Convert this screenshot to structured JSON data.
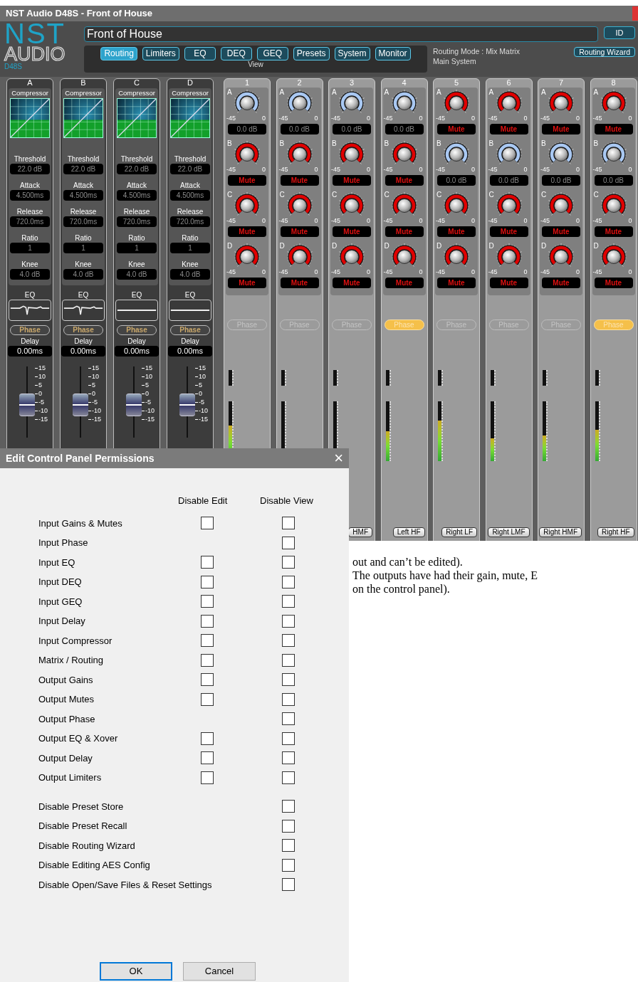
{
  "window": {
    "title": "NST Audio D48S - Front of House"
  },
  "logo": {
    "brand": "NST",
    "line2": "AUDIO",
    "model": "D48S"
  },
  "name_field": {
    "value": "Front of House"
  },
  "id_button": "ID",
  "tabs": [
    {
      "label": "Routing",
      "selected": true
    },
    {
      "label": "Limiters",
      "selected": false
    },
    {
      "label": "EQ",
      "selected": false
    },
    {
      "label": "DEQ",
      "selected": false
    },
    {
      "label": "GEQ",
      "selected": false
    },
    {
      "label": "Presets",
      "selected": false
    },
    {
      "label": "System",
      "selected": false
    },
    {
      "label": "Monitor",
      "selected": false
    }
  ],
  "tabs_caption": "View",
  "routing_mode": "Routing Mode : Mix Matrix",
  "system_name": "Main System",
  "routing_wizard": "Routing Wizard",
  "inputs": [
    {
      "letter": "A",
      "compressor": "Compressor",
      "params": [
        {
          "label": "Threshold",
          "value": "22.0 dB"
        },
        {
          "label": "Attack",
          "value": "4.500ms"
        },
        {
          "label": "Release",
          "value": "720.0ms"
        },
        {
          "label": "Ratio",
          "value": "1"
        },
        {
          "label": "Knee",
          "value": "4.0 dB"
        }
      ],
      "eq": {
        "label": "EQ",
        "kind": "notched"
      },
      "phase": "Phase",
      "delay_label": "Delay",
      "delay": "0.00ms",
      "fader": {
        "level": 0.5,
        "scale": [
          "15",
          "10",
          "5",
          "0",
          "-5",
          "-10",
          "-15"
        ]
      }
    },
    {
      "letter": "B",
      "compressor": "Compressor",
      "params": [
        {
          "label": "Threshold",
          "value": "22.0 dB"
        },
        {
          "label": "Attack",
          "value": "4.500ms"
        },
        {
          "label": "Release",
          "value": "720.0ms"
        },
        {
          "label": "Ratio",
          "value": "1"
        },
        {
          "label": "Knee",
          "value": "4.0 dB"
        }
      ],
      "eq": {
        "label": "EQ",
        "kind": "notched"
      },
      "phase": "Phase",
      "delay_label": "Delay",
      "delay": "0.00ms",
      "fader": {
        "level": 0.5,
        "scale": [
          "15",
          "10",
          "5",
          "0",
          "-5",
          "-10",
          "-15"
        ]
      }
    },
    {
      "letter": "C",
      "compressor": "Compressor",
      "params": [
        {
          "label": "Threshold",
          "value": "22.0 dB"
        },
        {
          "label": "Attack",
          "value": "4.500ms"
        },
        {
          "label": "Release",
          "value": "720.0ms"
        },
        {
          "label": "Ratio",
          "value": "1"
        },
        {
          "label": "Knee",
          "value": "4.0 dB"
        }
      ],
      "eq": {
        "label": "EQ",
        "kind": "flat"
      },
      "phase": "Phase",
      "delay_label": "Delay",
      "delay": "0.00ms",
      "fader": {
        "level": 0.5,
        "scale": [
          "15",
          "10",
          "5",
          "0",
          "-5",
          "-10",
          "-15"
        ]
      }
    },
    {
      "letter": "D",
      "compressor": "Compressor",
      "params": [
        {
          "label": "Threshold",
          "value": "22.0 dB"
        },
        {
          "label": "Attack",
          "value": "4.500ms"
        },
        {
          "label": "Release",
          "value": "720.0ms"
        },
        {
          "label": "Ratio",
          "value": "1"
        },
        {
          "label": "Knee",
          "value": "4.0 dB"
        }
      ],
      "eq": {
        "label": "EQ",
        "kind": "flat"
      },
      "phase": "Phase",
      "delay_label": "Delay",
      "delay": "0.00ms",
      "fader": {
        "level": 0.5,
        "scale": [
          "15",
          "10",
          "5",
          "0",
          "-5",
          "-10",
          "-15"
        ]
      }
    }
  ],
  "outputs": [
    {
      "number": "1",
      "knobs": [
        {
          "label": "A",
          "muted": false,
          "readout": "0.0 dB",
          "scale_min": "-45",
          "scale_max": "0"
        },
        {
          "label": "B",
          "muted": true,
          "readout": "Mute",
          "scale_min": "-45",
          "scale_max": "0"
        },
        {
          "label": "C",
          "muted": true,
          "readout": "Mute",
          "scale_min": "-45",
          "scale_max": "0"
        },
        {
          "label": "D",
          "muted": true,
          "readout": "Mute",
          "scale_min": "-45",
          "scale_max": "0"
        }
      ],
      "phase": {
        "label": "Phase",
        "on": false
      },
      "meter": {
        "level": 0.6
      }
    },
    {
      "number": "2",
      "knobs": [
        {
          "label": "A",
          "muted": false,
          "readout": "0.0 dB",
          "scale_min": "-45",
          "scale_max": "0"
        },
        {
          "label": "B",
          "muted": true,
          "readout": "Mute",
          "scale_min": "-45",
          "scale_max": "0"
        },
        {
          "label": "C",
          "muted": true,
          "readout": "Mute",
          "scale_min": "-45",
          "scale_max": "0"
        },
        {
          "label": "D",
          "muted": true,
          "readout": "Mute",
          "scale_min": "-45",
          "scale_max": "0"
        }
      ],
      "phase": {
        "label": "Phase",
        "on": false
      }
    },
    {
      "number": "3",
      "knobs": [
        {
          "label": "A",
          "muted": false,
          "readout": "0.0 dB",
          "scale_min": "-45",
          "scale_max": "0"
        },
        {
          "label": "B",
          "muted": true,
          "readout": "Mute",
          "scale_min": "-45",
          "scale_max": "0"
        },
        {
          "label": "C",
          "muted": true,
          "readout": "Mute",
          "scale_min": "-45",
          "scale_max": "0"
        },
        {
          "label": "D",
          "muted": true,
          "readout": "Mute",
          "scale_min": "-45",
          "scale_max": "0"
        }
      ],
      "phase": {
        "label": "Phase",
        "on": false
      },
      "name": "HMF"
    },
    {
      "number": "4",
      "knobs": [
        {
          "label": "A",
          "muted": false,
          "readout": "0.0 dB",
          "scale_min": "-45",
          "scale_max": "0"
        },
        {
          "label": "B",
          "muted": true,
          "readout": "Mute",
          "scale_min": "-45",
          "scale_max": "0"
        },
        {
          "label": "C",
          "muted": true,
          "readout": "Mute",
          "scale_min": "-45",
          "scale_max": "0"
        },
        {
          "label": "D",
          "muted": true,
          "readout": "Mute",
          "scale_min": "-45",
          "scale_max": "0"
        }
      ],
      "phase": {
        "label": "Phase",
        "on": true
      },
      "meter": {
        "level": 0.5
      },
      "name": "Left HF"
    },
    {
      "number": "5",
      "knobs": [
        {
          "label": "A",
          "muted": true,
          "readout": "Mute",
          "scale_min": "-45",
          "scale_max": "0"
        },
        {
          "label": "B",
          "muted": false,
          "readout": "0.0 dB",
          "scale_min": "-45",
          "scale_max": "0"
        },
        {
          "label": "C",
          "muted": true,
          "readout": "Mute",
          "scale_min": "-45",
          "scale_max": "0"
        },
        {
          "label": "D",
          "muted": true,
          "readout": "Mute",
          "scale_min": "-45",
          "scale_max": "0"
        }
      ],
      "phase": {
        "label": "Phase",
        "on": false
      },
      "meter": {
        "level": 0.68
      },
      "name": "Right LF"
    },
    {
      "number": "6",
      "knobs": [
        {
          "label": "A",
          "muted": true,
          "readout": "Mute",
          "scale_min": "-45",
          "scale_max": "0"
        },
        {
          "label": "B",
          "muted": false,
          "readout": "0.0 dB",
          "scale_min": "-45",
          "scale_max": "0"
        },
        {
          "label": "C",
          "muted": true,
          "readout": "Mute",
          "scale_min": "-45",
          "scale_max": "0"
        },
        {
          "label": "D",
          "muted": true,
          "readout": "Mute",
          "scale_min": "-45",
          "scale_max": "0"
        }
      ],
      "phase": {
        "label": "Phase",
        "on": false
      },
      "meter": {
        "level": 0.38
      },
      "name": "Right LMF"
    },
    {
      "number": "7",
      "knobs": [
        {
          "label": "A",
          "muted": true,
          "readout": "Mute",
          "scale_min": "-45",
          "scale_max": "0"
        },
        {
          "label": "B",
          "muted": false,
          "readout": "0.0 dB",
          "scale_min": "-45",
          "scale_max": "0"
        },
        {
          "label": "C",
          "muted": true,
          "readout": "Mute",
          "scale_min": "-45",
          "scale_max": "0"
        },
        {
          "label": "D",
          "muted": true,
          "readout": "Mute",
          "scale_min": "-45",
          "scale_max": "0"
        }
      ],
      "phase": {
        "label": "Phase",
        "on": false
      },
      "meter": {
        "level": 0.43
      },
      "name": "Right HMF"
    },
    {
      "number": "8",
      "knobs": [
        {
          "label": "A",
          "muted": true,
          "readout": "Mute",
          "scale_min": "-45",
          "scale_max": "0"
        },
        {
          "label": "B",
          "muted": false,
          "readout": "0.0 dB",
          "scale_min": "-45",
          "scale_max": "0"
        },
        {
          "label": "C",
          "muted": true,
          "readout": "Mute",
          "scale_min": "-45",
          "scale_max": "0"
        },
        {
          "label": "D",
          "muted": true,
          "readout": "Mute",
          "scale_min": "-45",
          "scale_max": "0"
        }
      ],
      "phase": {
        "label": "Phase",
        "on": true
      },
      "meter": {
        "level": 0.52
      },
      "name": "Right HF"
    }
  ],
  "document_lines": [
    "out and can’t be edited).",
    "The outputs have had their gain, mute, E",
    "on the control panel)."
  ],
  "dialog": {
    "title": "Edit Control Panel Permissions",
    "close": "×",
    "columns": [
      "Disable Edit",
      "Disable View"
    ],
    "groups": [
      {
        "rows": [
          {
            "label": "Input Gains & Mutes",
            "kind": "edit_view",
            "edit_checked": false,
            "view_checked": false
          },
          {
            "label": "Input Phase",
            "kind": "view",
            "view_checked": false
          },
          {
            "label": "Input EQ",
            "kind": "edit_view",
            "edit_checked": false,
            "view_checked": false
          },
          {
            "label": "Input DEQ",
            "kind": "edit_view",
            "edit_checked": false,
            "view_checked": false
          },
          {
            "label": "Input GEQ",
            "kind": "edit_view",
            "edit_checked": false,
            "view_checked": false
          },
          {
            "label": "Input Delay",
            "kind": "edit_view",
            "edit_checked": false,
            "view_checked": false
          },
          {
            "label": "Input Compressor",
            "kind": "edit_view",
            "edit_checked": false,
            "view_checked": false
          },
          {
            "label": "Matrix / Routing",
            "kind": "edit_view",
            "edit_checked": false,
            "view_checked": false
          },
          {
            "label": "Output Gains",
            "kind": "edit_view",
            "edit_checked": false,
            "view_checked": false
          },
          {
            "label": "Output Mutes",
            "kind": "edit_view",
            "edit_checked": false,
            "view_checked": false
          },
          {
            "label": "Output Phase",
            "kind": "view",
            "view_checked": false
          },
          {
            "label": "Output EQ & Xover",
            "kind": "edit_view",
            "edit_checked": false,
            "view_checked": false
          },
          {
            "label": "Output Delay",
            "kind": "edit_view",
            "edit_checked": false,
            "view_checked": false
          },
          {
            "label": "Output Limiters",
            "kind": "edit_view",
            "edit_checked": false,
            "view_checked": false
          }
        ]
      },
      {
        "rows": [
          {
            "label": "Disable Preset Store",
            "kind": "view",
            "view_checked": false
          },
          {
            "label": "Disable Preset Recall",
            "kind": "view",
            "view_checked": false
          },
          {
            "label": "Disable Routing Wizard",
            "kind": "view",
            "view_checked": false
          },
          {
            "label": "Disable Editing AES Config",
            "kind": "view",
            "view_checked": false
          },
          {
            "label": "Disable Open/Save Files & Reset Settings",
            "kind": "view",
            "view_checked": false
          }
        ]
      }
    ],
    "buttons": [
      {
        "label": "OK",
        "kind": "default"
      },
      {
        "label": "Cancel",
        "kind": "normal"
      }
    ]
  }
}
